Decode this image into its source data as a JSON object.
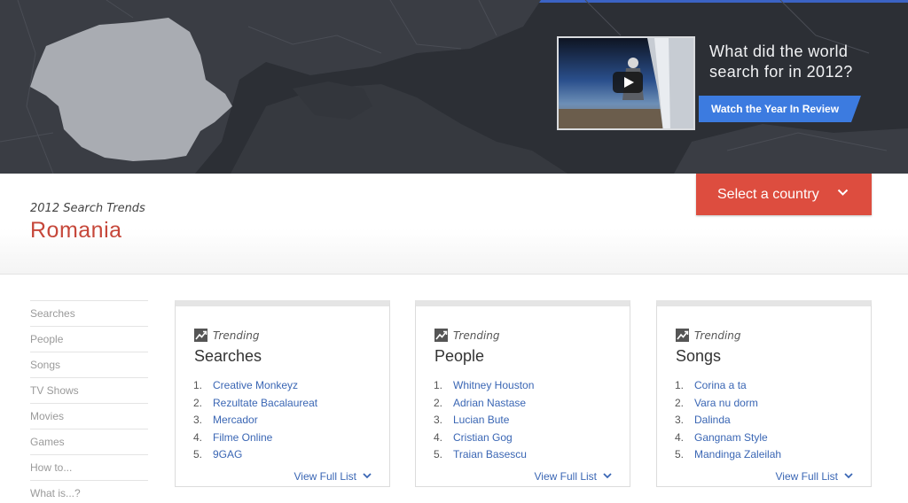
{
  "hero": {
    "question": "What did the world search for in 2012?",
    "watch_label": "Watch the Year In Review",
    "colors": {
      "background": "#2c2f35",
      "map_highlight": "#a9acb2",
      "accent": "#3c7be0"
    }
  },
  "header": {
    "subtitle": "2012 Search Trends",
    "country": "Romania",
    "select_label": "Select a country"
  },
  "sidebar": {
    "items": [
      {
        "label": "Searches"
      },
      {
        "label": "People"
      },
      {
        "label": "Songs"
      },
      {
        "label": "TV Shows"
      },
      {
        "label": "Movies"
      },
      {
        "label": "Games"
      },
      {
        "label": "How to..."
      },
      {
        "label": "What is...?"
      }
    ]
  },
  "cards": [
    {
      "kicker": "Trending",
      "title": "Searches",
      "items": [
        {
          "num": "1.",
          "label": "Creative Monkeyz"
        },
        {
          "num": "2.",
          "label": "Rezultate Bacalaureat"
        },
        {
          "num": "3.",
          "label": "Mercador"
        },
        {
          "num": "4.",
          "label": "Filme Online"
        },
        {
          "num": "5.",
          "label": "9GAG"
        }
      ],
      "view_label": "View Full List"
    },
    {
      "kicker": "Trending",
      "title": "People",
      "items": [
        {
          "num": "1.",
          "label": "Whitney Houston"
        },
        {
          "num": "2.",
          "label": "Adrian Nastase"
        },
        {
          "num": "3.",
          "label": "Lucian Bute"
        },
        {
          "num": "4.",
          "label": "Cristian Gog"
        },
        {
          "num": "5.",
          "label": "Traian Basescu"
        }
      ],
      "view_label": "View Full List"
    },
    {
      "kicker": "Trending",
      "title": "Songs",
      "items": [
        {
          "num": "1.",
          "label": "Corina a ta"
        },
        {
          "num": "2.",
          "label": "Vara nu dorm"
        },
        {
          "num": "3.",
          "label": "Dalinda"
        },
        {
          "num": "4.",
          "label": "Gangnam Style"
        },
        {
          "num": "5.",
          "label": "Mandinga Zaleilah"
        }
      ],
      "view_label": "View Full List"
    }
  ]
}
